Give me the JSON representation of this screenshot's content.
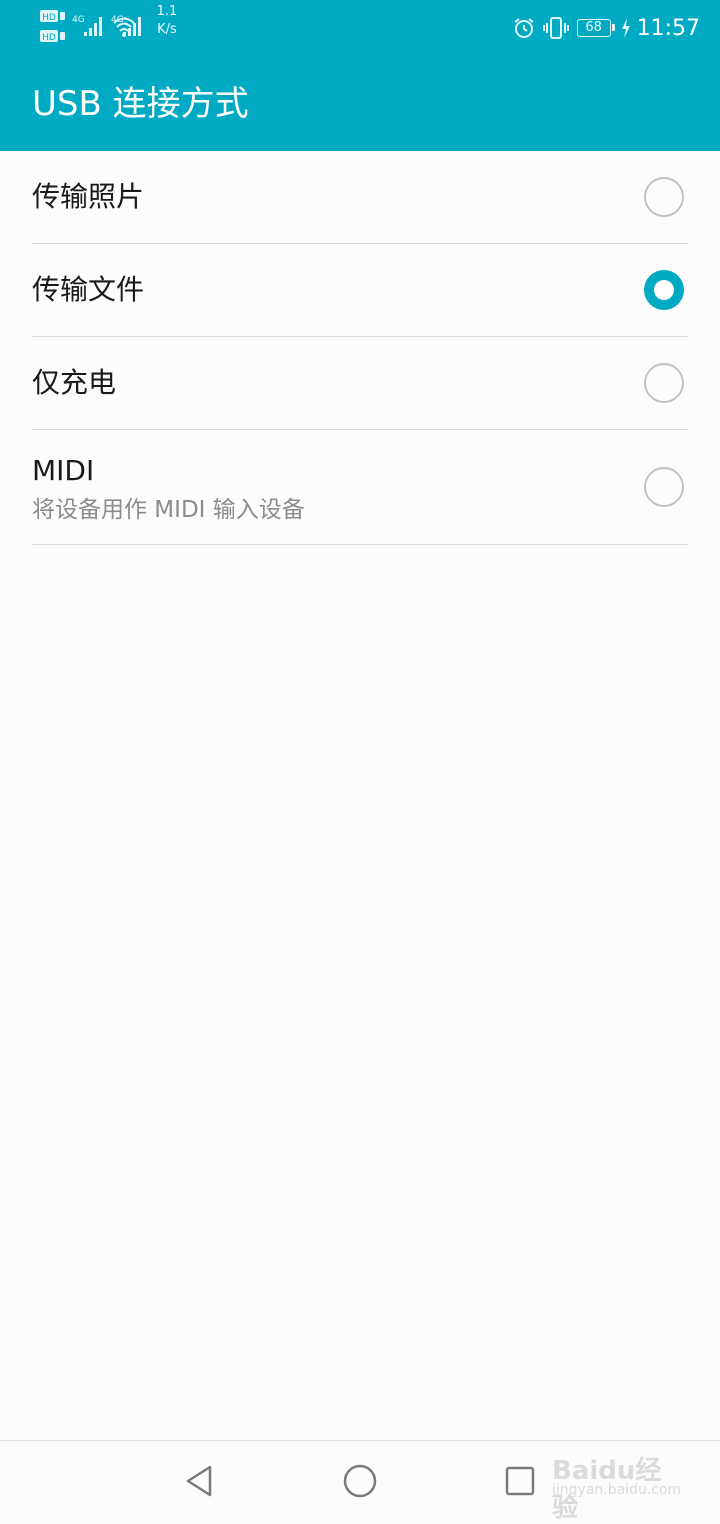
{
  "status_bar": {
    "hd_top": "HD",
    "hd_bottom": "HD",
    "net_4g_1": "4G",
    "net_4g_2": "4G",
    "net_speed_value": "1.1",
    "net_speed_unit": "K/s",
    "battery_level": "68",
    "time": "11:57"
  },
  "header": {
    "title": "USB 连接方式"
  },
  "options": [
    {
      "label": "传输照片",
      "selected": false
    },
    {
      "label": "传输文件",
      "selected": true
    },
    {
      "label": "仅充电",
      "selected": false
    },
    {
      "label": "MIDI",
      "subtitle": "将设备用作 MIDI 输入设备",
      "selected": false
    }
  ],
  "navigation": {
    "back": "back-icon",
    "home": "home-icon",
    "recents": "recents-icon"
  },
  "watermark": {
    "brand": "Bai",
    "brand_suffix": "du",
    "brand_cn": "经验",
    "url": "jingyan.baidu.com"
  },
  "colors": {
    "accent": "#00aac3",
    "divider": "#dcdcdc",
    "subtitle": "#8c8c8c"
  }
}
